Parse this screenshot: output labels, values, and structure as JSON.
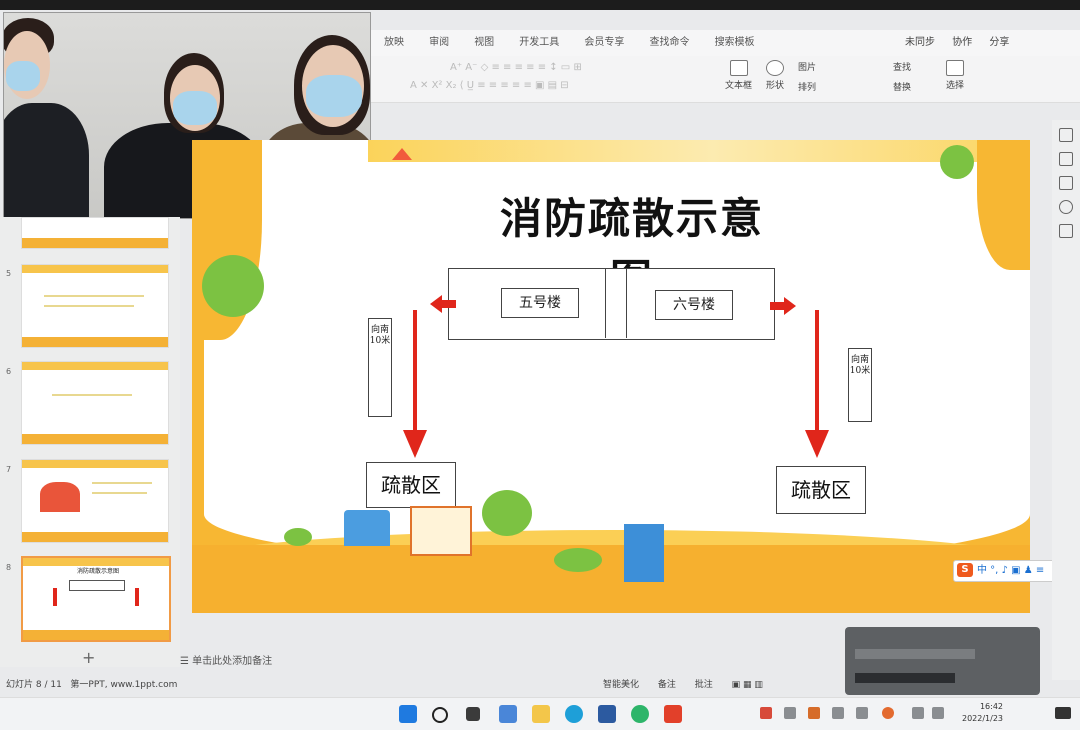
{
  "ribbon": {
    "tabs": [
      "放映",
      "审阅",
      "视图",
      "开发工具",
      "会员专享",
      "查找命令",
      "搜索模板"
    ],
    "right": [
      "未同步",
      "协作",
      "分享"
    ],
    "tools": [
      "文本框",
      "形状",
      "图片",
      "排列",
      "查找",
      "替换",
      "选择"
    ]
  },
  "slide": {
    "title": "消防疏散示意图",
    "building5": "五号楼",
    "building6": "六号楼",
    "dir_left": "向南10米",
    "dir_right": "向南10米",
    "zone_left": "疏散区",
    "zone_right": "疏散区"
  },
  "thumbnails": {
    "numbers": [
      "5",
      "6",
      "7",
      "8"
    ],
    "active_title": "消防疏散示意图"
  },
  "notes": {
    "placeholder": "单击此处添加备注"
  },
  "status": {
    "slide_counter": "幻灯片 8 / 11",
    "theme": "第一PPT, www.1ppt.com",
    "right": [
      "智能美化",
      "备注",
      "批注"
    ]
  },
  "taskbar": {
    "time": "16:42",
    "date": "2022/1/23"
  },
  "colors": {
    "arrow": "#e0261b",
    "slide_bg": "#f7b733",
    "accent": "#f19b45"
  }
}
